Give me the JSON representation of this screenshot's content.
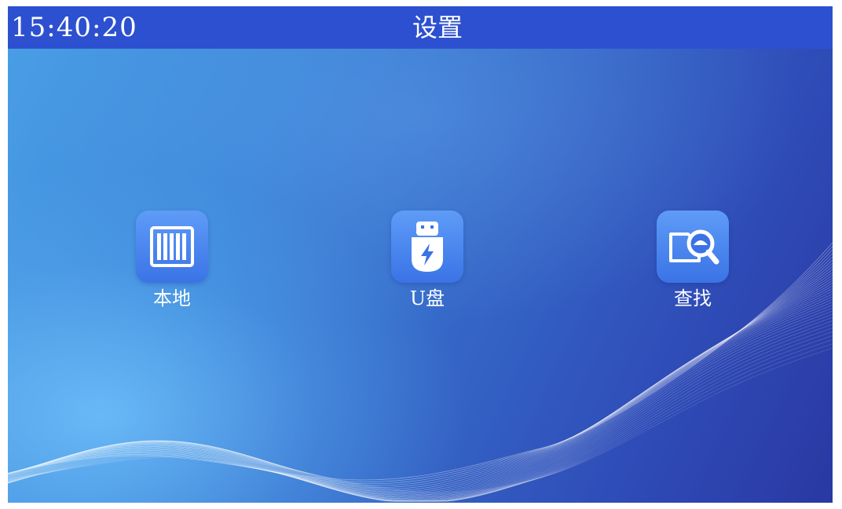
{
  "statusbar": {
    "time": "15:40:20",
    "title": "设置"
  },
  "tiles": [
    {
      "label": "本地",
      "icon": "storage-rack-icon"
    },
    {
      "label": "U盘",
      "icon": "usb-drive-icon"
    },
    {
      "label": "查找",
      "icon": "search-folder-icon"
    }
  ],
  "colors": {
    "topbar": "#2d50d0",
    "icon_tile": "#3b73e6",
    "text": "#ffffff"
  }
}
